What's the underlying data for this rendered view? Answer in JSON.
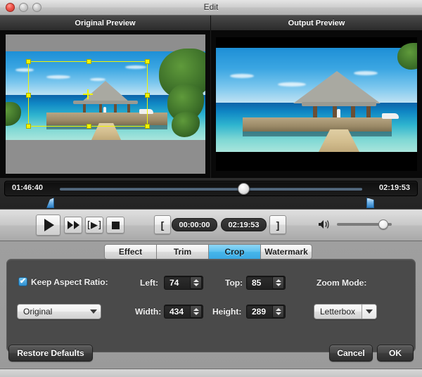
{
  "window": {
    "title": "Edit",
    "buttons": [
      {
        "name": "close",
        "icon": "close-circle-icon"
      },
      {
        "name": "minimize",
        "icon": "minimize-circle-icon"
      },
      {
        "name": "maximize",
        "icon": "maximize-circle-icon"
      }
    ]
  },
  "previews": {
    "original_label": "Original Preview",
    "output_label": "Output Preview"
  },
  "timeline": {
    "current_time": "01:46:40",
    "total_time": "02:19:53",
    "playhead_icon": "slider-knob-icon",
    "trim_start_icon": "trim-start-marker-icon",
    "trim_end_icon": "trim-end-marker-icon"
  },
  "controls": {
    "play_icon": "play-icon",
    "forward_icon": "fast-forward-icon",
    "step_icon": "frame-step-icon",
    "stop_icon": "stop-icon",
    "bracket_start": "[",
    "bracket_end": "]",
    "start_time": "00:00:00",
    "end_time": "02:19:53",
    "volume_icon": "volume-icon",
    "volume_knob_icon": "volume-knob-icon"
  },
  "tabs": [
    {
      "label": "Effect",
      "active": false
    },
    {
      "label": "Trim",
      "active": false
    },
    {
      "label": "Crop",
      "active": true
    },
    {
      "label": "Watermark",
      "active": false
    }
  ],
  "crop_panel": {
    "keep_aspect_label": "Keep Aspect Ratio:",
    "keep_aspect_checked": true,
    "check_glyph": "✔",
    "aspect_value": "Original",
    "left_label": "Left:",
    "left_value": "74",
    "top_label": "Top:",
    "top_value": "85",
    "width_label": "Width:",
    "width_value": "434",
    "height_label": "Height:",
    "height_value": "289",
    "zoom_mode_label": "Zoom Mode:",
    "zoom_mode_value": "Letterbox"
  },
  "footer": {
    "restore_label": "Restore Defaults",
    "cancel_label": "Cancel",
    "ok_label": "OK"
  },
  "colors": {
    "accent_blue": "#3ba9e3",
    "crop_yellow": "#f2f500",
    "panel_dark": "#4a4a4a",
    "chrome_gray": "#9f9f9f"
  }
}
